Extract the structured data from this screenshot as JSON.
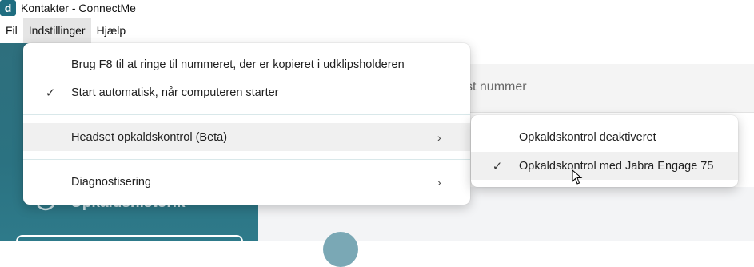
{
  "window": {
    "title": "Kontakter - ConnectMe",
    "app_icon_letter": "d"
  },
  "menubar": {
    "items": [
      {
        "label": "Fil",
        "active": false
      },
      {
        "label": "Indstillinger",
        "active": true
      },
      {
        "label": "Hjælp",
        "active": false
      }
    ]
  },
  "search": {
    "placeholder_fragment": "st nummer"
  },
  "sidebar": {
    "history_label": "Opkaldshistorik"
  },
  "dropdown": {
    "items": [
      {
        "label": "Brug F8 til at ringe til nummeret, der er kopieret i udklipsholderen",
        "checked": false
      },
      {
        "label": "Start automatisk, når computeren starter",
        "checked": true
      },
      {
        "label": "Headset opkaldskontrol (Beta)",
        "submenu": true
      },
      {
        "label": "Diagnostisering",
        "submenu": true
      }
    ]
  },
  "submenu": {
    "items": [
      {
        "label": "Opkaldskontrol deaktiveret",
        "checked": false
      },
      {
        "label": "Opkaldskontrol med Jabra Engage 75",
        "checked": true
      }
    ]
  },
  "glyphs": {
    "check": "✓",
    "chevron": "›"
  },
  "colors": {
    "sidebar": "#2e7381",
    "app_icon": "#1f6d80",
    "highlight": "#f0f0f0"
  }
}
